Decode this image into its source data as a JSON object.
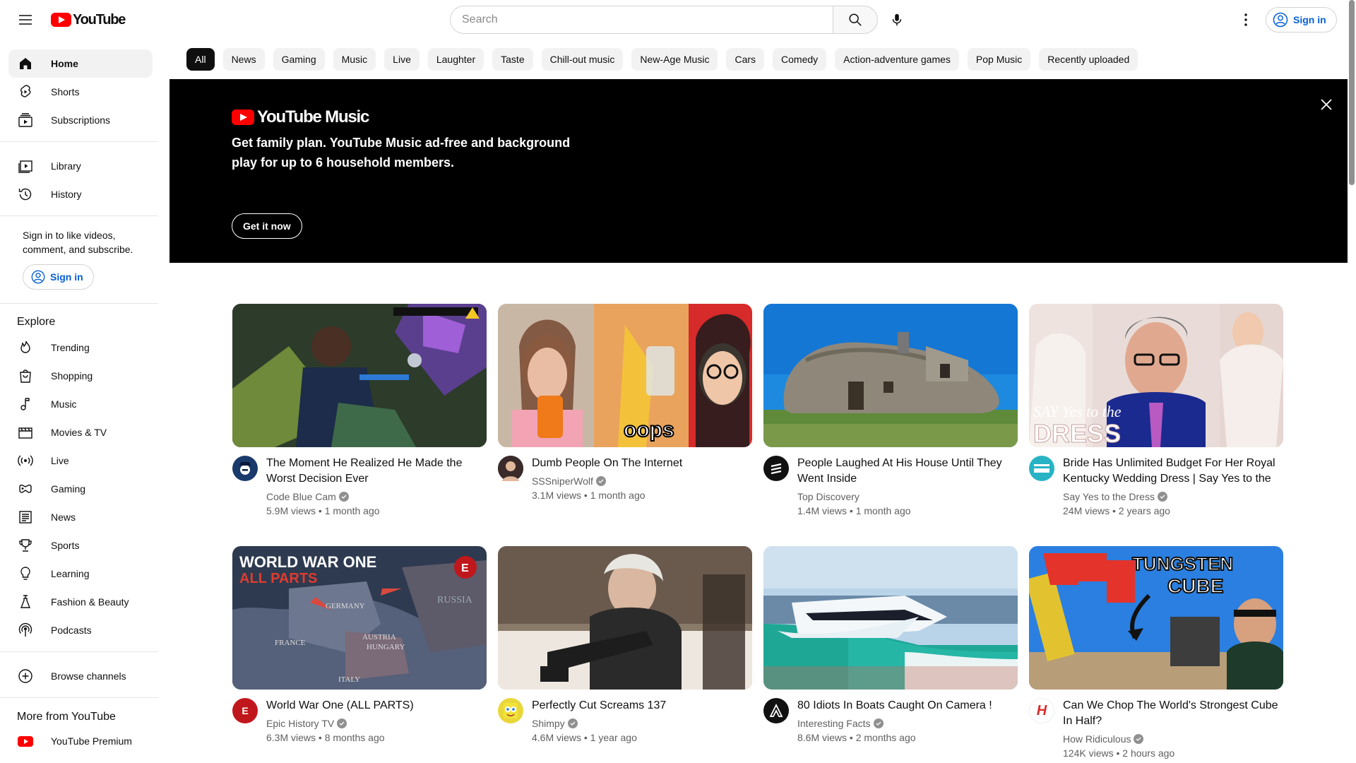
{
  "header": {
    "logo_text": "YouTube",
    "search_placeholder": "Search",
    "sign_in_label": "Sign in"
  },
  "sidebar": {
    "main": [
      {
        "label": "Home",
        "icon": "home-icon"
      },
      {
        "label": "Shorts",
        "icon": "shorts-icon"
      },
      {
        "label": "Subscriptions",
        "icon": "subscriptions-icon"
      }
    ],
    "library": [
      {
        "label": "Library",
        "icon": "library-icon"
      },
      {
        "label": "History",
        "icon": "history-icon"
      }
    ],
    "signin_prompt": "Sign in to like videos, comment, and subscribe.",
    "signin_button": "Sign in",
    "explore_heading": "Explore",
    "explore": [
      {
        "label": "Trending",
        "icon": "trending-icon"
      },
      {
        "label": "Shopping",
        "icon": "shopping-icon"
      },
      {
        "label": "Music",
        "icon": "music-icon"
      },
      {
        "label": "Movies & TV",
        "icon": "movies-icon"
      },
      {
        "label": "Live",
        "icon": "live-icon"
      },
      {
        "label": "Gaming",
        "icon": "gaming-icon"
      },
      {
        "label": "News",
        "icon": "news-icon"
      },
      {
        "label": "Sports",
        "icon": "sports-icon"
      },
      {
        "label": "Learning",
        "icon": "learning-icon"
      },
      {
        "label": "Fashion & Beauty",
        "icon": "fashion-icon"
      },
      {
        "label": "Podcasts",
        "icon": "podcasts-icon"
      }
    ],
    "browse_channels": "Browse channels",
    "more_heading": "More from YouTube",
    "premium": "YouTube Premium"
  },
  "chips": [
    "All",
    "News",
    "Gaming",
    "Music",
    "Live",
    "Laughter",
    "Taste",
    "Chill-out music",
    "New-Age Music",
    "Cars",
    "Comedy",
    "Action-adventure games",
    "Pop Music",
    "Recently uploaded"
  ],
  "banner": {
    "logo_text": "YouTube Music",
    "text": "Get family plan. YouTube Music ad-free and background play for up to 6 household members.",
    "button": "Get it now"
  },
  "videos": [
    {
      "title": "The Moment He Realized He Made the Worst Decision Ever",
      "channel": "Code Blue Cam",
      "stats": "5.9M views • 1 month ago",
      "verified": true,
      "avatar_color": "#1a3a6b"
    },
    {
      "title": "Dumb People On The Internet",
      "channel": "SSSniperWolf",
      "stats": "3.1M views • 1 month ago",
      "verified": true,
      "avatar_color": "#3a2a2a"
    },
    {
      "title": "People Laughed At His House Until They Went Inside",
      "channel": "Top Discovery",
      "stats": "1.4M views • 1 month ago",
      "verified": false,
      "avatar_color": "#111111"
    },
    {
      "title": "Bride Has Unlimited Budget For Her Royal Kentucky Wedding Dress | Say Yes to the Dress",
      "channel": "Say Yes to the Dress",
      "stats": "24M views • 2 years ago",
      "verified": true,
      "avatar_color": "#27b3c4"
    },
    {
      "title": "World War One (ALL PARTS)",
      "channel": "Epic History TV",
      "stats": "6.3M views • 8 months ago",
      "verified": true,
      "avatar_color": "#c0171c"
    },
    {
      "title": "Perfectly Cut Screams 137",
      "channel": "Shimpy",
      "stats": "4.6M views • 1 year ago",
      "verified": true,
      "avatar_color": "#e9d73a"
    },
    {
      "title": "80 Idiots In Boats Caught On Camera !",
      "channel": "Interesting Facts",
      "stats": "8.6M views • 2 months ago",
      "verified": true,
      "avatar_color": "#111111"
    },
    {
      "title": "Can We Chop The World's Strongest Cube In Half?",
      "channel": "How Ridiculous",
      "stats": "124K views • 2 hours ago",
      "verified": true,
      "avatar_color": "#ffffff"
    }
  ],
  "thumb_texts": {
    "v2_caption": "oops",
    "v4_caption_a": "SAY Yes to the",
    "v4_caption_b": "DRESS",
    "v5_title_a": "WORLD WAR ONE",
    "v5_title_b": "ALL PARTS",
    "v5_badge": "E",
    "v5_germany": "GERMANY",
    "v5_austria": "AUSTRIA",
    "v5_hungary": "HUNGARY",
    "v5_france": "FRANCE",
    "v5_italy": "ITALY",
    "v5_russia": "RUSSIA",
    "v8_title_a": "TUNGSTEN",
    "v8_title_b": "CUBE"
  },
  "avatar_letters": {
    "v5": "E",
    "v8": "H"
  }
}
